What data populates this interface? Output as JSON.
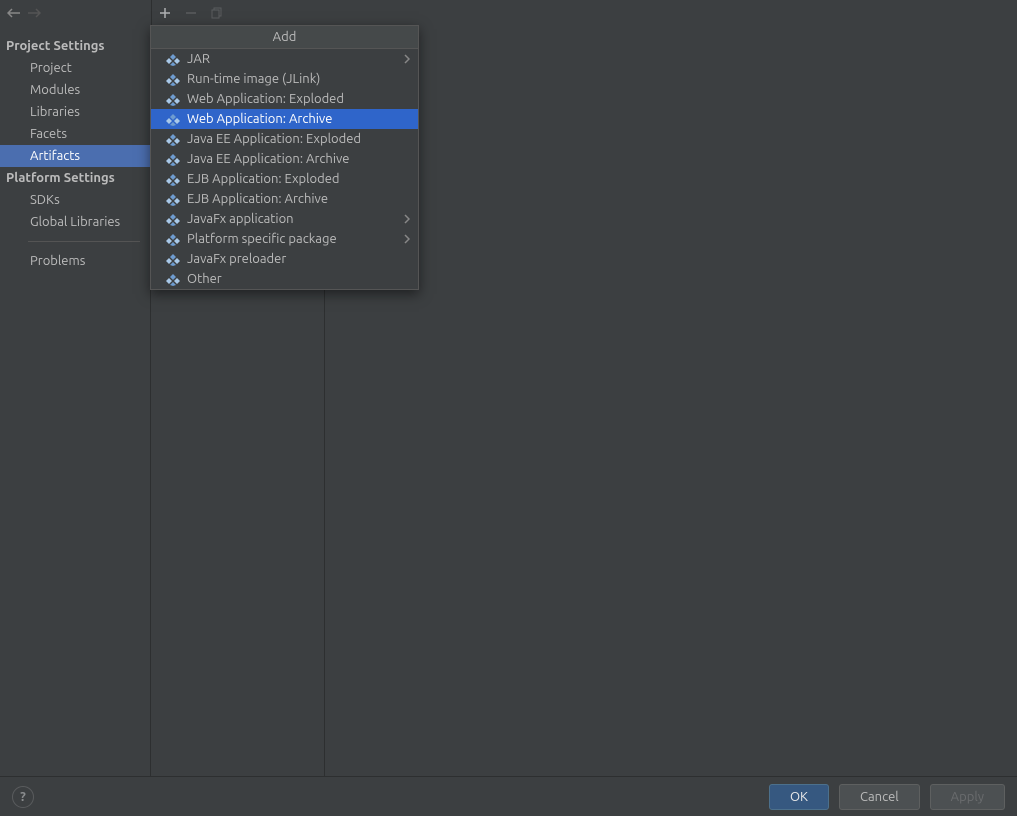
{
  "sidebar": {
    "section1": {
      "header": "Project Settings",
      "items": [
        {
          "label": "Project"
        },
        {
          "label": "Modules"
        },
        {
          "label": "Libraries"
        },
        {
          "label": "Facets"
        },
        {
          "label": "Artifacts",
          "selected": true
        }
      ]
    },
    "section2": {
      "header": "Platform Settings",
      "items": [
        {
          "label": "SDKs"
        },
        {
          "label": "Global Libraries"
        }
      ]
    },
    "section3": {
      "items": [
        {
          "label": "Problems"
        }
      ]
    }
  },
  "popup": {
    "title": "Add",
    "items": [
      {
        "label": "JAR",
        "icon": "jar-icon",
        "submenu": true
      },
      {
        "label": "Run-time image (JLink)",
        "icon": "jlink-icon"
      },
      {
        "label": "Web Application: Exploded",
        "icon": "web-exploded-icon"
      },
      {
        "label": "Web Application: Archive",
        "icon": "web-archive-icon",
        "highlighted": true
      },
      {
        "label": "Java EE Application: Exploded",
        "icon": "ee-exploded-icon"
      },
      {
        "label": "Java EE Application: Archive",
        "icon": "ee-archive-icon"
      },
      {
        "label": "EJB Application: Exploded",
        "icon": "ejb-exploded-icon"
      },
      {
        "label": "EJB Application: Archive",
        "icon": "ejb-archive-icon"
      },
      {
        "label": "JavaFx application",
        "icon": "javafx-icon",
        "submenu": true
      },
      {
        "label": "Platform specific package",
        "icon": "package-icon",
        "submenu": true
      },
      {
        "label": "JavaFx preloader",
        "icon": "preloader-icon"
      },
      {
        "label": "Other",
        "icon": "other-icon"
      }
    ]
  },
  "footer": {
    "ok": "OK",
    "cancel": "Cancel",
    "apply": "Apply"
  }
}
